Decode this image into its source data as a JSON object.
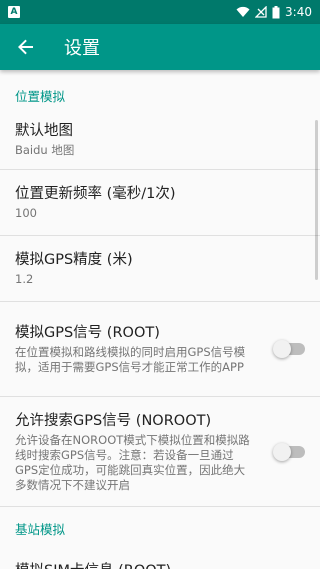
{
  "statusbar": {
    "app_badge": "A",
    "time": "3:40"
  },
  "toolbar": {
    "title": "设置"
  },
  "sections": [
    {
      "category": "位置模拟",
      "items": [
        {
          "title": "默认地图",
          "summary": "Baidu 地图",
          "has_switch": false
        },
        {
          "title": "位置更新频率 (毫秒/1次)",
          "summary": "100",
          "has_switch": false
        },
        {
          "title": "模拟GPS精度 (米)",
          "summary": "1.2",
          "has_switch": false
        },
        {
          "title": "模拟GPS信号 (ROOT)",
          "summary": "在位置模拟和路线模拟的同时启用GPS信号模拟，适用于需要GPS信号才能正常工作的APP",
          "has_switch": true,
          "checked": false
        },
        {
          "title": "允许搜索GPS信号 (NOROOT)",
          "summary": "允许设备在NOROOT模式下模拟位置和模拟路线时搜索GPS信号。注意：若设备一旦通过GPS定位成功，可能跳回真实位置，因此绝大多数情况下不建议开启",
          "has_switch": true,
          "checked": false
        }
      ]
    },
    {
      "category": "基站模拟",
      "items": [
        {
          "title": "模拟SIM卡信息 (ROOT)",
          "summary": "",
          "has_switch": false
        }
      ]
    }
  ],
  "colors": {
    "statusbar": "#00796b",
    "toolbar": "#009688",
    "accent": "#009688"
  }
}
